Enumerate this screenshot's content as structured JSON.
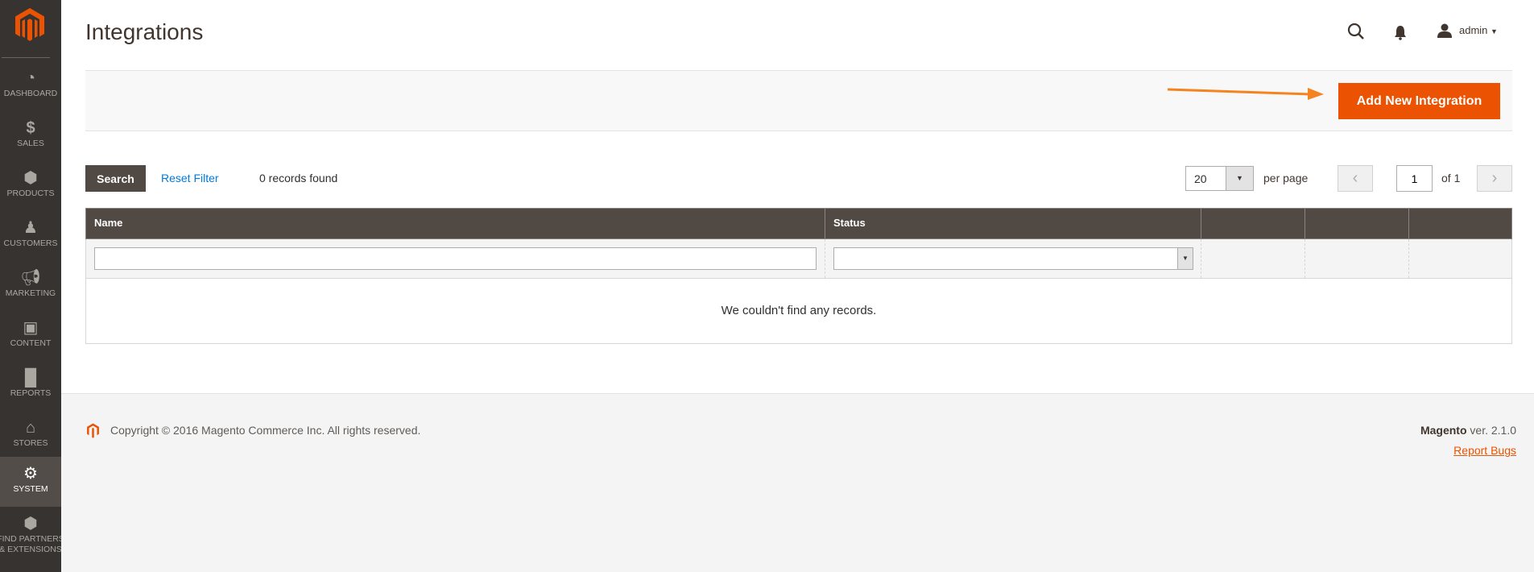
{
  "header": {
    "title": "Integrations",
    "user": "admin"
  },
  "sidebar": {
    "items": [
      {
        "label": "DASHBOARD",
        "icon": "dashboard-icon"
      },
      {
        "label": "SALES",
        "icon": "dollar-icon"
      },
      {
        "label": "PRODUCTS",
        "icon": "box-icon"
      },
      {
        "label": "CUSTOMERS",
        "icon": "person-icon"
      },
      {
        "label": "MARKETING",
        "icon": "megaphone-icon"
      },
      {
        "label": "CONTENT",
        "icon": "layout-icon"
      },
      {
        "label": "REPORTS",
        "icon": "bar-chart-icon"
      },
      {
        "label": "STORES",
        "icon": "store-icon"
      },
      {
        "label": "SYSTEM",
        "icon": "gear-icon",
        "active": true
      },
      {
        "label": "FIND PARTNERS & EXTENSIONS",
        "icon": "lego-icon"
      }
    ]
  },
  "actions": {
    "add_label": "Add New Integration"
  },
  "grid": {
    "search_label": "Search",
    "reset_label": "Reset Filter",
    "records_found": "0 records found",
    "per_page_value": "20",
    "per_page_label": "per page",
    "page": "1",
    "of_pages": "of 1",
    "columns": [
      "Name",
      "Status",
      "",
      "",
      ""
    ],
    "empty_message": "We couldn't find any records."
  },
  "footer": {
    "copyright": "Copyright © 2016 Magento Commerce Inc. All rights reserved.",
    "brand": "Magento",
    "version": "ver. 2.1.0",
    "report_bugs": "Report Bugs"
  },
  "colors": {
    "accent": "#eb5202",
    "sidebar": "#373330",
    "grid_header": "#514943",
    "link": "#007bdb"
  }
}
